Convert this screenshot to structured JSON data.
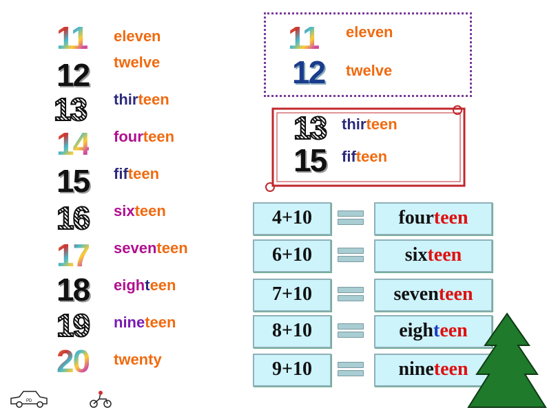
{
  "left_list": [
    {
      "number": "11",
      "style": "colorful",
      "parts": [
        {
          "t": "eleven",
          "c": "#f06a10"
        }
      ]
    },
    {
      "number": "12",
      "style": "black",
      "parts": [
        {
          "t": "twelve",
          "c": "#f06a10"
        }
      ]
    },
    {
      "number": "13",
      "style": "hatched",
      "parts": [
        {
          "t": "thir",
          "c": "#2b2a7a"
        },
        {
          "t": "teen",
          "c": "#f06a10"
        }
      ]
    },
    {
      "number": "14",
      "style": "colorful",
      "parts": [
        {
          "t": "four",
          "c": "#b0108f"
        },
        {
          "t": "teen",
          "c": "#f06a10"
        }
      ]
    },
    {
      "number": "15",
      "style": "black",
      "parts": [
        {
          "t": "fif",
          "c": "#2b2a7a"
        },
        {
          "t": "teen",
          "c": "#f06a10"
        }
      ]
    },
    {
      "number": "16",
      "style": "hatched",
      "parts": [
        {
          "t": "six",
          "c": "#b0108f"
        },
        {
          "t": "teen",
          "c": "#f06a10"
        }
      ]
    },
    {
      "number": "17",
      "style": "colorful",
      "parts": [
        {
          "t": "seven",
          "c": "#b0108f"
        },
        {
          "t": "teen",
          "c": "#f06a10"
        }
      ]
    },
    {
      "number": "18",
      "style": "black",
      "parts": [
        {
          "t": "eigh",
          "c": "#b0108f"
        },
        {
          "t": "t",
          "c": "#2b2a7a"
        },
        {
          "t": "een",
          "c": "#f06a10"
        }
      ]
    },
    {
      "number": "19",
      "style": "hatched",
      "parts": [
        {
          "t": "nine",
          "c": "#7a1ab0"
        },
        {
          "t": "teen",
          "c": "#f06a10"
        }
      ]
    },
    {
      "number": "20",
      "style": "colorful",
      "parts": [
        {
          "t": "twenty",
          "c": "#f06a10"
        }
      ]
    }
  ],
  "dashed_box": [
    {
      "number": "11",
      "parts": [
        {
          "t": "eleven",
          "c": "#f06a10"
        }
      ]
    },
    {
      "number": "12",
      "parts": [
        {
          "t": "twelve",
          "c": "#f06a10"
        }
      ]
    }
  ],
  "scroll_box": [
    {
      "number": "13",
      "parts": [
        {
          "t": "thir",
          "c": "#2b2a7a"
        },
        {
          "t": "teen",
          "c": "#f06a10"
        }
      ]
    },
    {
      "number": "15",
      "parts": [
        {
          "t": "fif",
          "c": "#2b2a7a"
        },
        {
          "t": "teen",
          "c": "#f06a10"
        }
      ]
    }
  ],
  "equations": [
    {
      "sum": "4+10",
      "parts": [
        {
          "t": "four",
          "c": "#111111"
        },
        {
          "t": "teen",
          "c": "#e01010"
        }
      ]
    },
    {
      "sum": "6+10",
      "parts": [
        {
          "t": "six",
          "c": "#111111"
        },
        {
          "t": "teen",
          "c": "#e01010"
        }
      ]
    },
    {
      "sum": "7+10",
      "parts": [
        {
          "t": "seven",
          "c": "#111111"
        },
        {
          "t": "teen",
          "c": "#e01010"
        }
      ]
    },
    {
      "sum": "8+10",
      "parts": [
        {
          "t": "eigh",
          "c": "#111111"
        },
        {
          "t": "t",
          "c": "#1a3cc0"
        },
        {
          "t": "een",
          "c": "#e01010"
        }
      ]
    },
    {
      "sum": "9+10",
      "parts": [
        {
          "t": "nine",
          "c": "#111111"
        },
        {
          "t": "teen",
          "c": "#e01010"
        }
      ]
    }
  ],
  "icons": {
    "car": "police-car-icon",
    "bike": "motorbike-icon",
    "tree": "pine-tree-icon"
  },
  "car_label": "PD"
}
